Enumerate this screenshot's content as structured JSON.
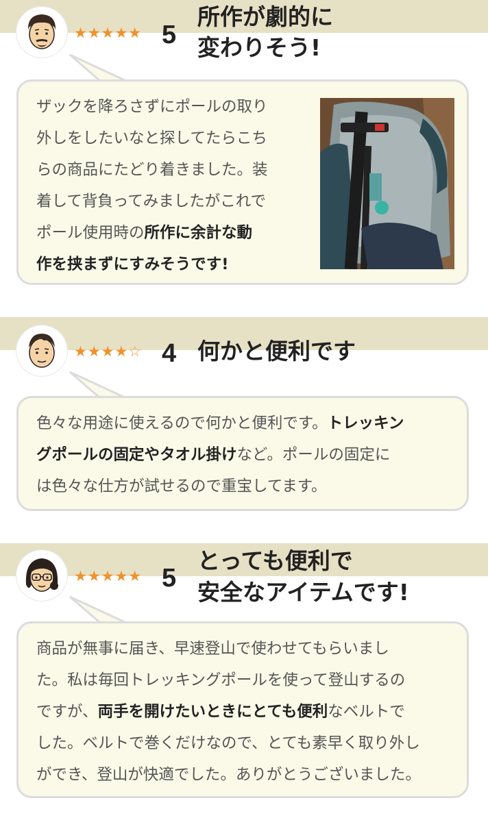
{
  "reviews": [
    {
      "stars": "★★★★★",
      "rating": "5",
      "title_line1": "所作が劇的に",
      "title_line2": "変わりそう!",
      "lines": [
        {
          "plain": "ザックを降ろさずにポールの取り"
        },
        {
          "plain": "外しをしたいなと探してたらこち"
        },
        {
          "plain": "らの商品にたどり着きました。装"
        },
        {
          "plain": "着して背負ってみましたがこれで"
        },
        {
          "plain": "ポール使用時の",
          "bold": "所作に余計な動"
        },
        {
          "bold": "作を挟まずにすみそうです!"
        }
      ],
      "photo_icon": "backpack-trekking-pole-photo"
    },
    {
      "stars": "★★★★☆",
      "rating": "4",
      "title_line1": "何かと便利です",
      "lines": [
        {
          "plain": "色々な用途に使えるので何かと便利です。",
          "bold": "トレッキン"
        },
        {
          "bold": "グポールの固定やタオル掛け",
          "plain": "など。ポールの固定に"
        },
        {
          "plain": "は色々な仕方が試せるので重宝してます。"
        }
      ]
    },
    {
      "stars": "★★★★★",
      "rating": "5",
      "title_line1": "とっても便利で",
      "title_line2": "安全なアイテムです!",
      "lines": [
        {
          "plain": "商品が無事に届き、早速登山で使わせてもらいまし"
        },
        {
          "plain": "た。私は毎回トレッキングポールを使って登山するの"
        },
        {
          "plain": "ですが、",
          "bold": "両手を開けたいときにとても便利",
          "plain2": "なベルトで"
        },
        {
          "plain": "した。ベルトで巻くだけなので、とても素早く取り外し"
        },
        {
          "plain": "ができ、登山が快適でした。ありがとうございました。"
        }
      ]
    }
  ],
  "colors": {
    "band": "#e6e0c5",
    "bubble": "#fbf9e8",
    "border": "#dcdcdc",
    "star": "#f0912a"
  }
}
